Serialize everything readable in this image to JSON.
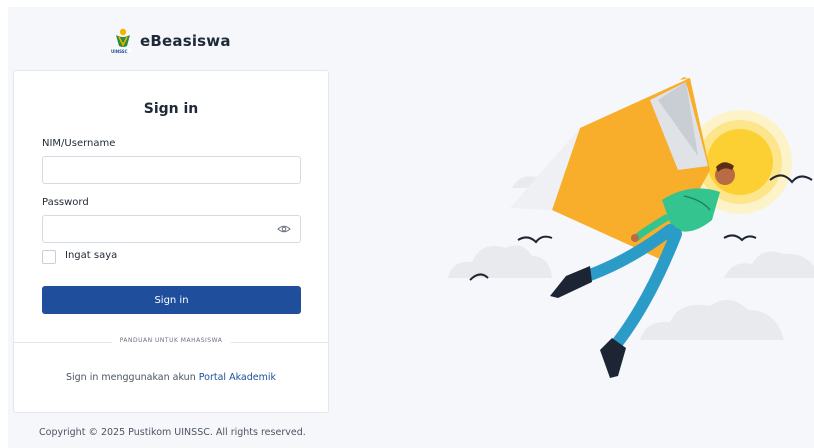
{
  "brand": {
    "name": "eBeasiswa",
    "logo_text": "UINSSC",
    "logo_icon": "uinssc-logo-icon"
  },
  "login": {
    "title": "Sign in",
    "username_label": "NIM/Username",
    "username_value": "",
    "password_label": "Password",
    "password_value": "",
    "show_password_icon": "eye-icon",
    "remember_label": "Ingat saya",
    "remember_checked": false,
    "submit_label": "Sign in",
    "divider_label": "PANDUAN UNTUK MAHASISWA",
    "portal_prefix": "Sign in menggunakan akun ",
    "portal_link": "Portal Akademik"
  },
  "footer": {
    "copyright": "Copyright © 2025 Pustikom UINSSC. All rights reserved."
  },
  "colors": {
    "primary": "#1f4e9c",
    "background": "#f5f7fb",
    "book": "#f8ad2b",
    "sun": "#fcd033"
  }
}
